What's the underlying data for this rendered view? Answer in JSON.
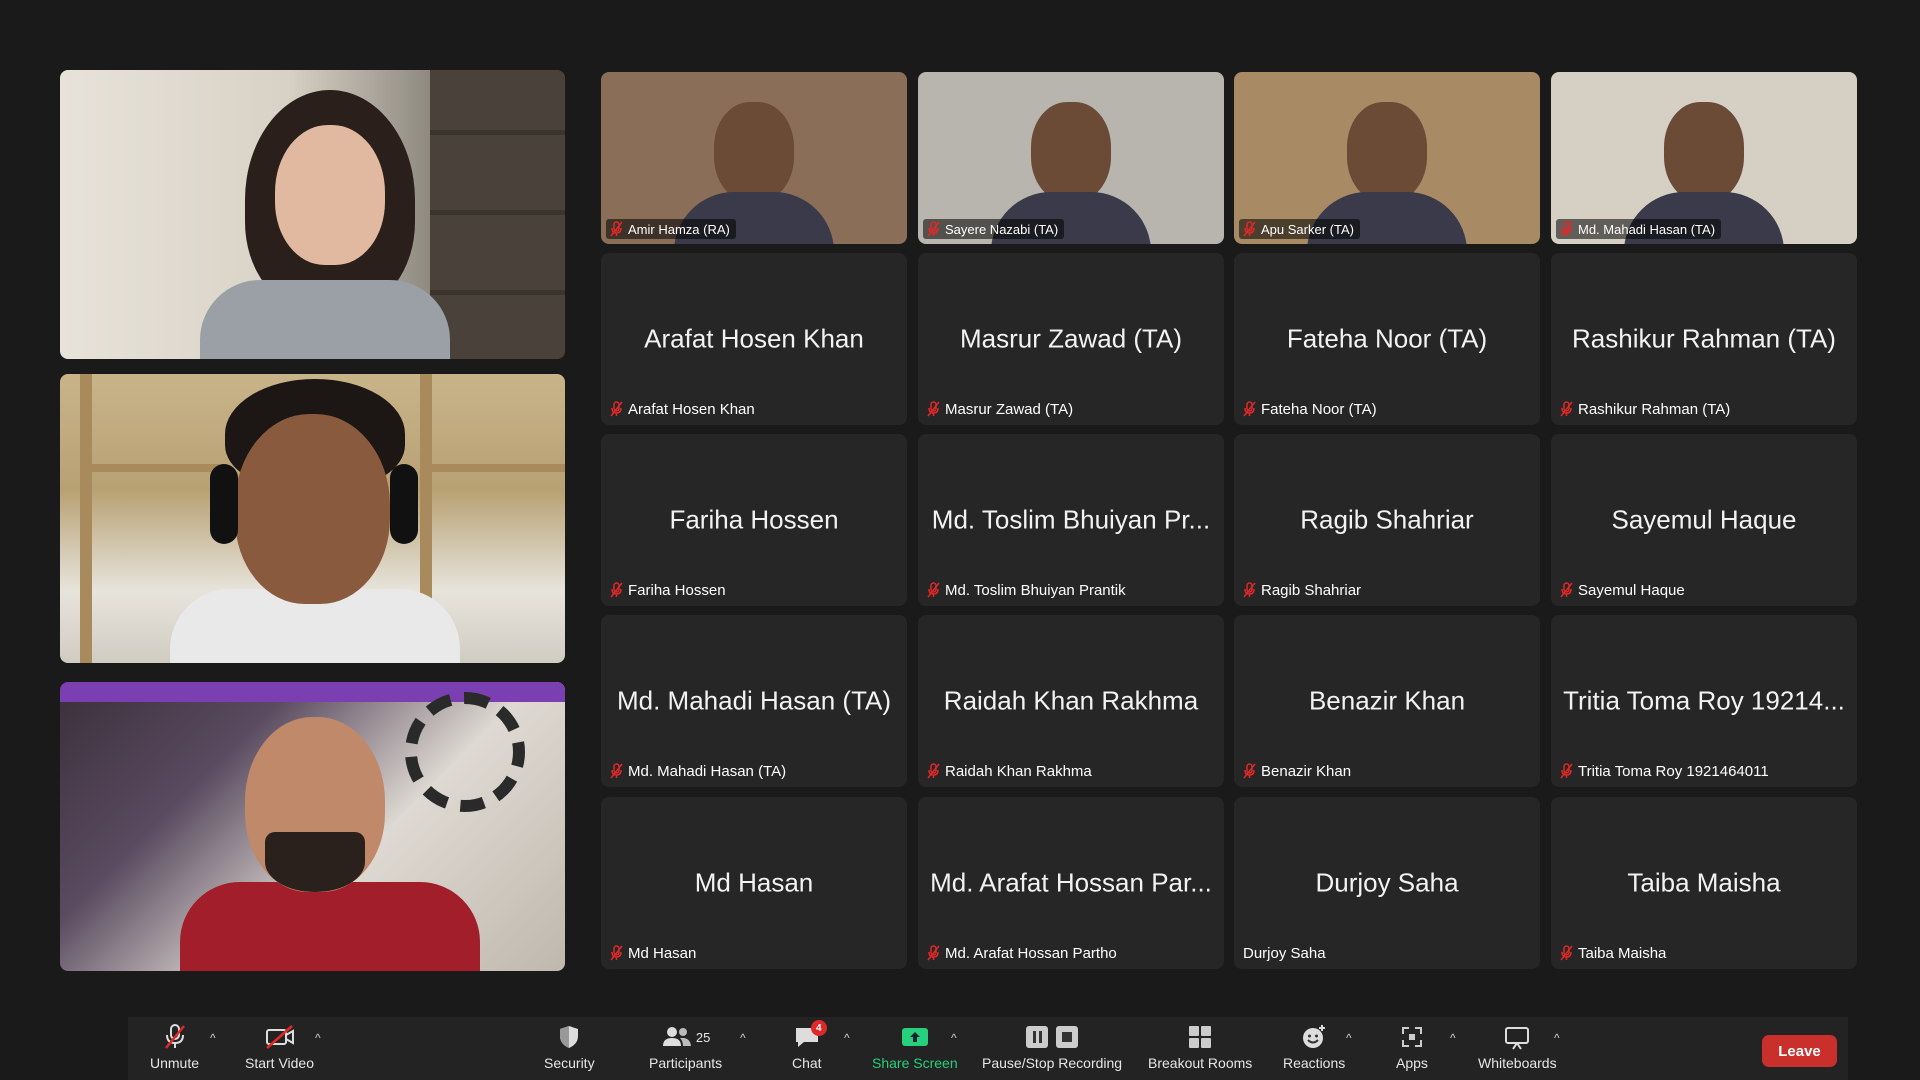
{
  "featured": [
    {
      "id": "big-1"
    },
    {
      "id": "big-2"
    },
    {
      "id": "big-3"
    }
  ],
  "grid": [
    {
      "display": "",
      "label": "Amir Hamza (RA)",
      "video": true,
      "muted": true
    },
    {
      "display": "",
      "label": "Sayere Nazabi (TA)",
      "video": true,
      "muted": true
    },
    {
      "display": "",
      "label": "Apu Sarker (TA)",
      "video": true,
      "muted": true
    },
    {
      "display": "",
      "label": "Md. Mahadi Hasan (TA)",
      "video": true,
      "muted": true
    },
    {
      "display": "Arafat Hosen Khan",
      "label": "Arafat Hosen Khan",
      "video": false,
      "muted": true
    },
    {
      "display": "Masrur Zawad (TA)",
      "label": "Masrur Zawad (TA)",
      "video": false,
      "muted": true
    },
    {
      "display": "Fateha Noor (TA)",
      "label": "Fateha Noor (TA)",
      "video": false,
      "muted": true
    },
    {
      "display": "Rashikur Rahman (TA)",
      "label": "Rashikur Rahman (TA)",
      "video": false,
      "muted": true
    },
    {
      "display": "Fariha Hossen",
      "label": "Fariha Hossen",
      "video": false,
      "muted": true
    },
    {
      "display": "Md. Toslim Bhuiyan Pr...",
      "label": "Md. Toslim Bhuiyan Prantik",
      "video": false,
      "muted": true
    },
    {
      "display": "Ragib Shahriar",
      "label": "Ragib Shahriar",
      "video": false,
      "muted": true
    },
    {
      "display": "Sayemul Haque",
      "label": "Sayemul Haque",
      "video": false,
      "muted": true
    },
    {
      "display": "Md. Mahadi Hasan (TA)",
      "label": "Md. Mahadi Hasan (TA)",
      "video": false,
      "muted": true
    },
    {
      "display": "Raidah Khan Rakhma",
      "label": "Raidah Khan Rakhma",
      "video": false,
      "muted": true
    },
    {
      "display": "Benazir Khan",
      "label": "Benazir Khan",
      "video": false,
      "muted": true
    },
    {
      "display": "Tritia Toma Roy 19214...",
      "label": "Tritia Toma Roy 1921464011",
      "video": false,
      "muted": true
    },
    {
      "display": "Md Hasan",
      "label": "Md Hasan",
      "video": false,
      "muted": true
    },
    {
      "display": "Md. Arafat Hossan Par...",
      "label": "Md. Arafat Hossan Partho",
      "video": false,
      "muted": true
    },
    {
      "display": "Durjoy Saha",
      "label": "Durjoy Saha",
      "video": false,
      "muted": false
    },
    {
      "display": "Taiba Maisha",
      "label": "Taiba Maisha",
      "video": false,
      "muted": true
    }
  ],
  "toolbar": {
    "unmute": "Unmute",
    "start_video": "Start Video",
    "security": "Security",
    "participants": "Participants",
    "participant_count": "25",
    "chat": "Chat",
    "chat_badge": "4",
    "share_screen": "Share Screen",
    "recording": "Pause/Stop Recording",
    "breakout": "Breakout Rooms",
    "reactions": "Reactions",
    "apps": "Apps",
    "whiteboards": "Whiteboards",
    "leave": "Leave",
    "caret": "^"
  },
  "colors": {
    "background": "#1a1a1a",
    "tile": "#262626",
    "toolbar": "#232323",
    "share_green": "#26d07c",
    "leave_red": "#c9302c",
    "mute_red": "#e02828"
  }
}
